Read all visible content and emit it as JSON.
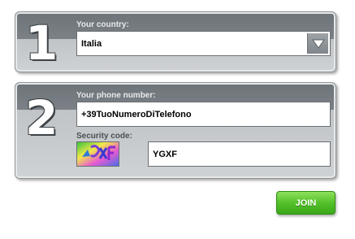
{
  "step1": {
    "number": "1",
    "country_label": "Your country:",
    "country_value": "Italia"
  },
  "step2": {
    "number": "2",
    "phone_label": "Your phone number:",
    "phone_value": "+39TuoNumeroDiTelefono",
    "security_label": "Security code:",
    "security_value": "YGXF"
  },
  "join_label": "JOIN",
  "colors": {
    "panel_dark": "#6d7479",
    "panel_light": "#cfd2d4",
    "join_green": "#54c12a"
  },
  "icons": {
    "dropdown": "chevron-down-icon",
    "captcha": "captcha-image"
  }
}
